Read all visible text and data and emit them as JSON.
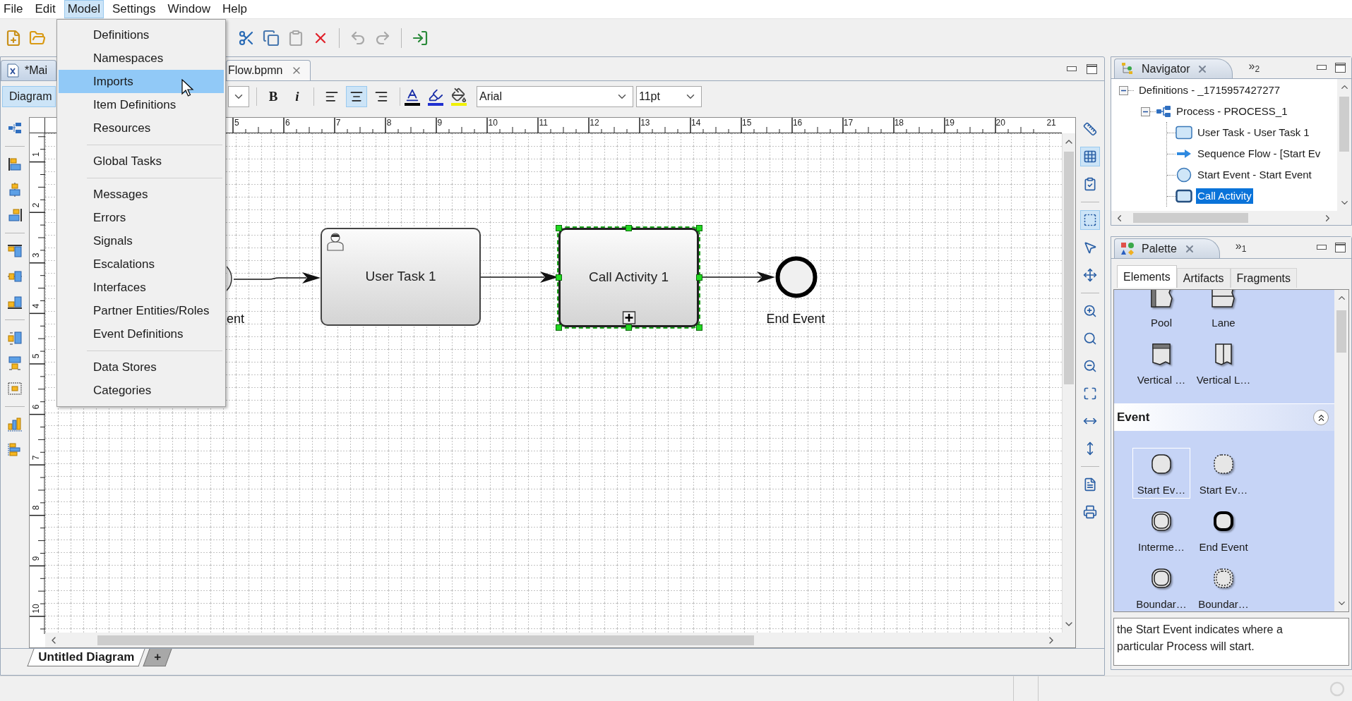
{
  "menu_bar": [
    {
      "label": "File",
      "selected": false
    },
    {
      "label": "Edit",
      "selected": false
    },
    {
      "label": "Model",
      "selected": true,
      "items": [
        {
          "kind": "item",
          "label": "Definitions",
          "selected": false
        },
        {
          "kind": "item",
          "label": "Namespaces",
          "selected": false
        },
        {
          "kind": "item",
          "label": "Imports",
          "selected": true
        },
        {
          "kind": "item",
          "label": "Item Definitions",
          "selected": false
        },
        {
          "kind": "item",
          "label": "Resources",
          "selected": false
        },
        {
          "kind": "separator"
        },
        {
          "kind": "item",
          "label": "Global Tasks",
          "selected": false
        },
        {
          "kind": "separator"
        },
        {
          "kind": "item",
          "label": "Messages",
          "selected": false
        },
        {
          "kind": "item",
          "label": "Errors",
          "selected": false
        },
        {
          "kind": "item",
          "label": "Signals",
          "selected": false
        },
        {
          "kind": "item",
          "label": "Escalations",
          "selected": false
        },
        {
          "kind": "item",
          "label": "Interfaces",
          "selected": false
        },
        {
          "kind": "item",
          "label": "Partner Entities/Roles",
          "selected": false
        },
        {
          "kind": "item",
          "label": "Event Definitions",
          "selected": false
        },
        {
          "kind": "separator"
        },
        {
          "kind": "item",
          "label": "Data Stores",
          "selected": false
        },
        {
          "kind": "item",
          "label": "Categories",
          "selected": false
        }
      ]
    },
    {
      "label": "Settings",
      "selected": false
    },
    {
      "label": "Window",
      "selected": false
    },
    {
      "label": "Help",
      "selected": false
    }
  ],
  "toolbar": [
    {
      "kind": "new",
      "disabled": false
    },
    {
      "kind": "open",
      "disabled": false
    },
    {
      "kind": "cut",
      "disabled": false
    },
    {
      "kind": "copy",
      "disabled": false
    },
    {
      "kind": "paste",
      "disabled": true
    },
    {
      "kind": "delete",
      "disabled": false
    },
    {
      "kind": "undo",
      "disabled": true
    },
    {
      "kind": "redo",
      "disabled": true
    },
    {
      "kind": "export",
      "disabled": false
    }
  ],
  "editor": {
    "tabs": [
      {
        "label": "*Mai",
        "selected": true
      },
      {
        "label": "Flow.bpmn",
        "selected": false
      }
    ],
    "format_bar": {
      "view_button": "Diagram",
      "bold": "B",
      "italic": "i",
      "alignment": [
        {
          "kind": "left",
          "selected": false
        },
        {
          "kind": "center",
          "selected": true
        },
        {
          "kind": "right",
          "selected": false
        }
      ],
      "font": "Arial",
      "size": "11pt"
    },
    "horizontal_ruler": [
      "5",
      "6",
      "7",
      "8",
      "9",
      "10",
      "11",
      "12",
      "13",
      "14",
      "15",
      "16",
      "17",
      "18",
      "19",
      "20",
      "21"
    ],
    "vertical_ruler": [
      "1",
      "2",
      "3",
      "4",
      "5",
      "6",
      "7",
      "8",
      "9",
      "10"
    ],
    "diagram": [
      {
        "kind": "start_event",
        "label": "ent",
        "selected": false
      },
      {
        "kind": "user_task",
        "label": "User Task 1",
        "selected": false
      },
      {
        "kind": "call_activity",
        "label": "Call Activity 1",
        "selected": true
      },
      {
        "kind": "end_event",
        "label": "End Event",
        "selected": false
      }
    ],
    "tools": [
      {
        "kind": "ruler",
        "selected": false
      },
      {
        "kind": "grid",
        "selected": true
      },
      {
        "kind": "validate",
        "selected": false
      },
      {
        "kind": "marquee",
        "selected": true
      },
      {
        "kind": "pointer",
        "selected": false
      },
      {
        "kind": "pan",
        "selected": false
      },
      {
        "kind": "zoom_in",
        "selected": false
      },
      {
        "kind": "zoom",
        "selected": false
      },
      {
        "kind": "zoom_out",
        "selected": false
      },
      {
        "kind": "fit",
        "selected": false
      },
      {
        "kind": "fit_width",
        "selected": false
      },
      {
        "kind": "fit_height",
        "selected": false
      },
      {
        "kind": "document",
        "selected": false
      },
      {
        "kind": "print",
        "selected": false
      }
    ],
    "diagram_tabs": [
      {
        "label": "Untitled Diagram",
        "selected": true
      },
      {
        "label": "+",
        "selected": false
      }
    ]
  },
  "navigator": {
    "tab": "Navigator",
    "overflow": "»$_{2}$",
    "tree": [
      {
        "label": "Definitions - _1715957427277",
        "kind": "definitions",
        "expanded": true,
        "selected": false,
        "children": [
          {
            "label": "Process - PROCESS_1",
            "kind": "process",
            "expanded": true,
            "selected": false,
            "children": [
              {
                "label": "User Task - User Task 1",
                "kind": "task",
                "selected": false
              },
              {
                "label": "Sequence Flow - [Start Ev",
                "kind": "flow",
                "selected": false
              },
              {
                "label": "Start Event - Start Event",
                "kind": "event",
                "selected": false
              },
              {
                "label": "Call Activity",
                "kind": "activity",
                "selected": true
              }
            ]
          }
        ]
      }
    ]
  },
  "palette": {
    "tab": "Palette",
    "overflow": "»$_{1}$",
    "tabs": [
      {
        "label": "Elements",
        "selected": true
      },
      {
        "label": "Artifacts",
        "selected": false
      },
      {
        "label": "Fragments",
        "selected": false
      }
    ],
    "groups": [
      {
        "items": [
          {
            "label": "Pool",
            "kind": "pool",
            "selected": false
          },
          {
            "label": "Lane",
            "kind": "lane",
            "selected": false
          },
          {
            "label": "Vertical …",
            "kind": "vertical_pool",
            "selected": false
          },
          {
            "label": "Vertical L…",
            "kind": "vertical_lane",
            "selected": false
          }
        ]
      },
      {
        "title": "Event",
        "expanded": true,
        "items": [
          {
            "label": "Start Ev…",
            "kind": "start",
            "selected": true
          },
          {
            "label": "Start Ev…",
            "kind": "start_non_interrupting",
            "selected": false
          },
          {
            "label": "Interme…",
            "kind": "intermediate",
            "selected": false
          },
          {
            "label": "End Event",
            "kind": "end",
            "selected": false
          },
          {
            "label": "Boundar…",
            "kind": "boundary",
            "selected": false
          },
          {
            "label": "Boundar…",
            "kind": "boundary_non_interrupting",
            "selected": false
          }
        ]
      }
    ],
    "description": "the Start Event indicates where a particular Process will start."
  }
}
